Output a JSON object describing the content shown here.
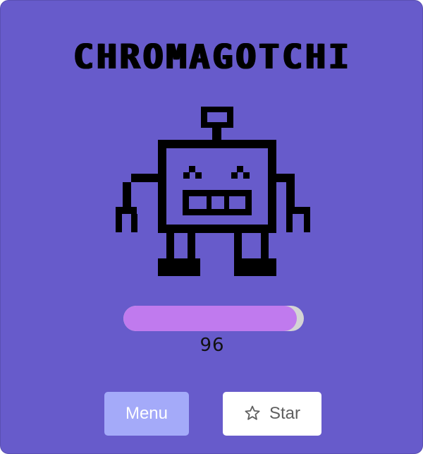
{
  "app": {
    "title": "CHROMAGOTCHI"
  },
  "pet": {
    "icon": "pixel-robot-icon",
    "level": 96,
    "level_max": 100,
    "level_label": "96"
  },
  "buttons": {
    "menu_label": "Menu",
    "star_label": "Star",
    "star_icon": "star-outline-icon"
  },
  "colors": {
    "background": "#675BCB",
    "progress_fill": "#C07AEE",
    "progress_track": "#D4D4D4",
    "menu_button": "#A4AAF9",
    "star_button": "#FFFFFF"
  }
}
